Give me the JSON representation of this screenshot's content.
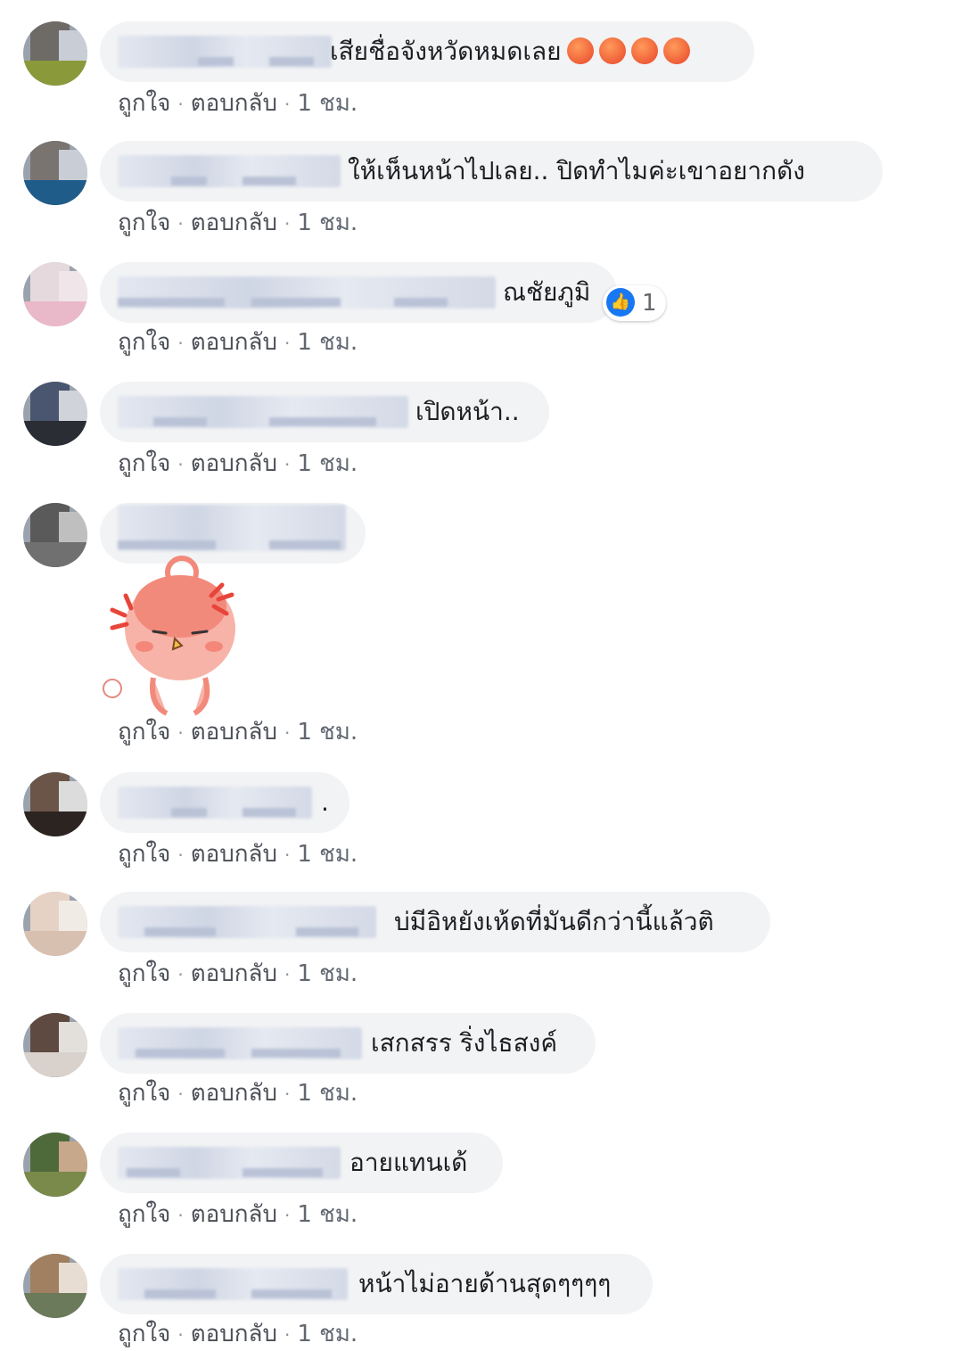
{
  "actions": {
    "like": "ถูกใจ",
    "reply": "ตอบกลับ",
    "separator": "·",
    "time": "1 ชม."
  },
  "colors": {
    "bubble": "#f2f3f5",
    "text": "#1c1e21",
    "meta": "#606770",
    "like_blue": "#1877f2"
  },
  "comments": [
    {
      "text": "เสียชื่อจังหวัดหมดเลย",
      "emoji": [
        "angry-face-icon",
        "angry-face-icon",
        "angry-face-icon",
        "angry-face-icon"
      ]
    },
    {
      "text": "ให้เห็นหน้าไปเลย.. ปิดทำไมค่ะเขาอยากดัง"
    },
    {
      "text": "ณชัยภูมิ",
      "likes": "1"
    },
    {
      "text": "เปิดหน้า.."
    },
    {
      "text": "",
      "sticker": "angry-chick-sticker"
    },
    {
      "text": "."
    },
    {
      "text": "บ่มีอิหยังเห้ดที่มันดีกว่านี้แล้วติ"
    },
    {
      "text": "เสกสรร ริ่งไธสงค์"
    },
    {
      "text": "อายแทนเด้"
    },
    {
      "text": "หน้าไม่อายด้านสุดๆๆๆๆ"
    }
  ]
}
